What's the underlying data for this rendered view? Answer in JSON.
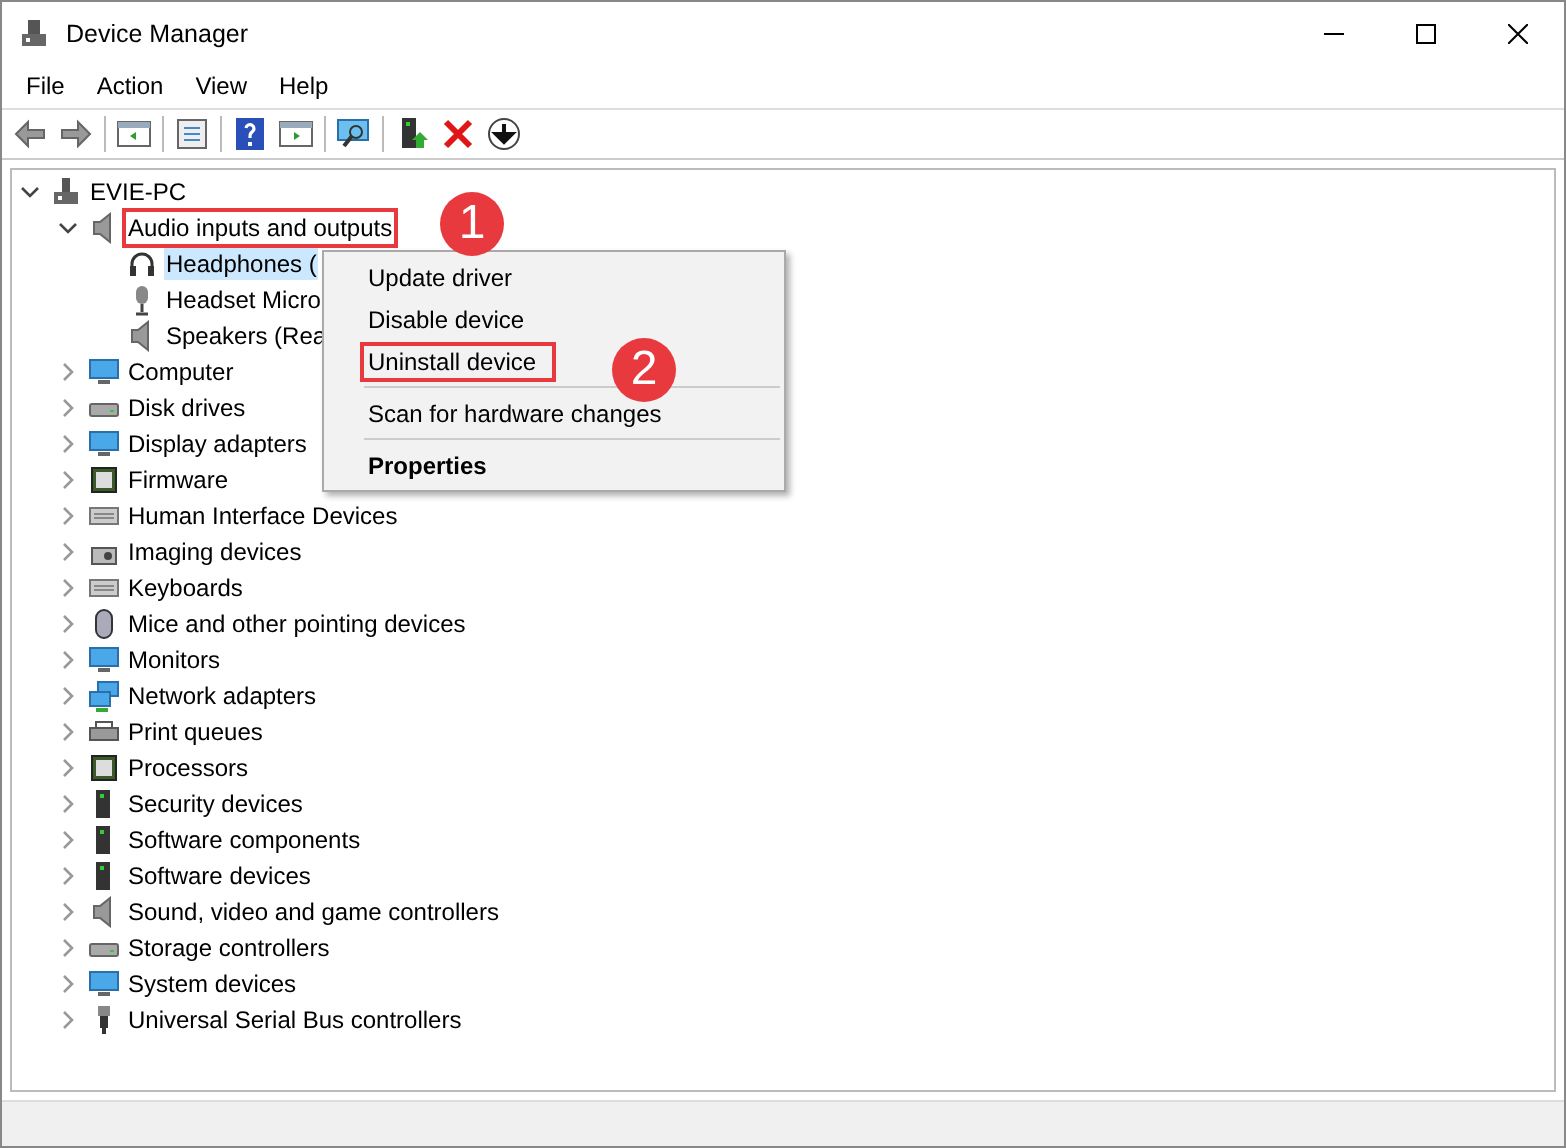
{
  "window": {
    "title": "Device Manager"
  },
  "menu_bar": [
    {
      "label": "File"
    },
    {
      "label": "Action"
    },
    {
      "label": "View"
    },
    {
      "label": "Help"
    }
  ],
  "tree": {
    "label": "EVIE-PC",
    "expanded": true,
    "selected": false,
    "highlighted": false,
    "children": [
      {
        "label": "Audio inputs and outputs",
        "expanded": true,
        "selected": false,
        "highlighted": true,
        "children": [
          {
            "label": "Headphones (",
            "selected": true,
            "highlighted": false
          },
          {
            "label": "Headset Micro",
            "selected": false,
            "highlighted": false
          },
          {
            "label": "Speakers (Rea",
            "selected": false,
            "highlighted": false
          }
        ]
      },
      {
        "label": "Computer",
        "expanded": false,
        "selected": false,
        "highlighted": false
      },
      {
        "label": "Disk drives",
        "expanded": false,
        "selected": false,
        "highlighted": false
      },
      {
        "label": "Display adapters",
        "expanded": false,
        "selected": false,
        "highlighted": false
      },
      {
        "label": "Firmware",
        "expanded": false,
        "selected": false,
        "highlighted": false
      },
      {
        "label": "Human Interface Devices",
        "expanded": false,
        "selected": false,
        "highlighted": false
      },
      {
        "label": "Imaging devices",
        "expanded": false,
        "selected": false,
        "highlighted": false
      },
      {
        "label": "Keyboards",
        "expanded": false,
        "selected": false,
        "highlighted": false
      },
      {
        "label": "Mice and other pointing devices",
        "expanded": false,
        "selected": false,
        "highlighted": false
      },
      {
        "label": "Monitors",
        "expanded": false,
        "selected": false,
        "highlighted": false
      },
      {
        "label": "Network adapters",
        "expanded": false,
        "selected": false,
        "highlighted": false
      },
      {
        "label": "Print queues",
        "expanded": false,
        "selected": false,
        "highlighted": false
      },
      {
        "label": "Processors",
        "expanded": false,
        "selected": false,
        "highlighted": false
      },
      {
        "label": "Security devices",
        "expanded": false,
        "selected": false,
        "highlighted": false
      },
      {
        "label": "Software components",
        "expanded": false,
        "selected": false,
        "highlighted": false
      },
      {
        "label": "Software devices",
        "expanded": false,
        "selected": false,
        "highlighted": false
      },
      {
        "label": "Sound, video and game controllers",
        "expanded": false,
        "selected": false,
        "highlighted": false
      },
      {
        "label": "Storage controllers",
        "expanded": false,
        "selected": false,
        "highlighted": false
      },
      {
        "label": "System devices",
        "expanded": false,
        "selected": false,
        "highlighted": false
      },
      {
        "label": "Universal Serial Bus controllers",
        "expanded": false,
        "selected": false,
        "highlighted": false
      }
    ]
  },
  "context_menu": {
    "items": [
      {
        "kind": "item",
        "label": "Update driver",
        "bold": false,
        "highlighted": false
      },
      {
        "kind": "item",
        "label": "Disable device",
        "bold": false,
        "highlighted": false
      },
      {
        "kind": "item",
        "label": "Uninstall device",
        "bold": false,
        "highlighted": true
      },
      {
        "kind": "separator"
      },
      {
        "kind": "item",
        "label": "Scan for hardware changes",
        "bold": false,
        "highlighted": false
      },
      {
        "kind": "separator"
      },
      {
        "kind": "item",
        "label": "Properties",
        "bold": true,
        "highlighted": false
      }
    ]
  },
  "annotations": [
    {
      "label": "1"
    },
    {
      "label": "2"
    }
  ]
}
